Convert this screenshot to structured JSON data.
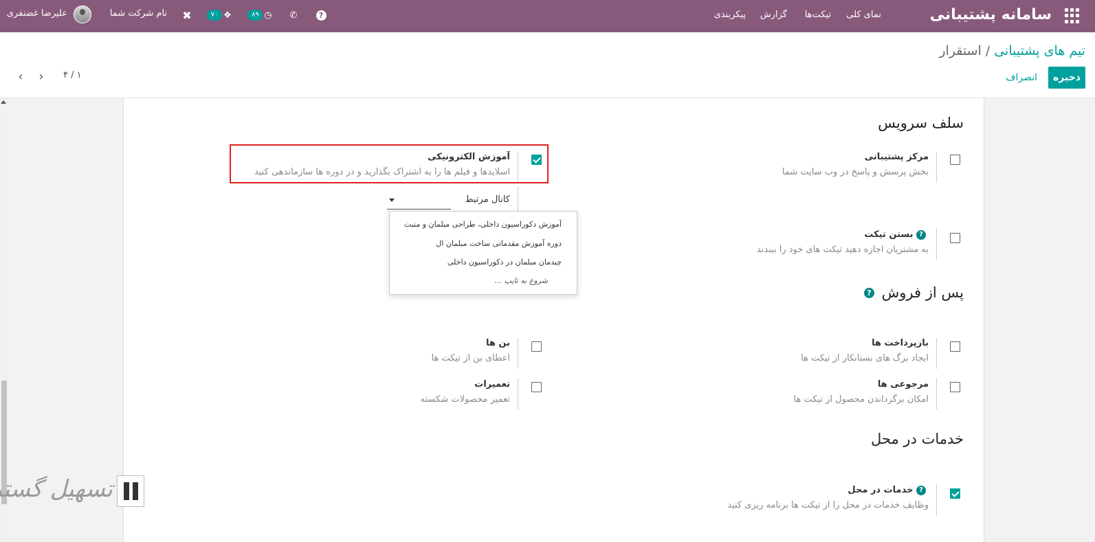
{
  "navbar": {
    "brand": "سامانه پشتیبانی",
    "menu": [
      "نمای کلی",
      "تیکت‌ها",
      "گزارش",
      "پیکربندی"
    ],
    "activity_count": "۸۹",
    "messages_count": "۷۰",
    "company": "نام شرکت شما",
    "username": "علیرضا غضنفری",
    "bg_color": "#875a7b"
  },
  "control_panel": {
    "breadcrumb_parent": "تیم های پشتیبانی",
    "breadcrumb_separator": "/",
    "breadcrumb_current": "استقرار",
    "save_label": "ذخیره",
    "discard_label": "انصراف",
    "pager": "۴ / ۱"
  },
  "sections": {
    "self_service": {
      "title": "سلف سرویس",
      "help_center": {
        "title": "مرکز پشتیبانی",
        "desc": "بخش پرسش و پاسخ در وب سایت شما",
        "checked": false
      },
      "elearning": {
        "title": "آموزش الکترونیکی",
        "desc": "اسلایدها و فیلم ها را به اشتراک بگذارید و در دوره ها سازماندهی کنید",
        "checked": true
      },
      "close_ticket": {
        "title": "بستن تیکت",
        "desc": "به مشتریان اجازه دهید تیکت های خود را ببندند",
        "checked": false
      },
      "channel_label": "کانال مرتبط",
      "channel_options": [
        "آموزش دکوراسیون داخلی، طراحی مبلمان و منبت",
        "دوره آموزش مقدماتی ساخت مبلمان ال",
        "چیدمان مبلمان در دکوراسیون داخلی"
      ],
      "channel_hint": "شروع به تایپ ..."
    },
    "after_sales": {
      "title": "پس از فروش",
      "refunds": {
        "title": "بازپرداخت ها",
        "desc": "ایجاد برگ های بستانکار از تیکت ها",
        "checked": false
      },
      "coupons": {
        "title": "بن ها",
        "desc": "اعطای بن از تیکت ها",
        "checked": false
      },
      "returns": {
        "title": "مرجوعی ها",
        "desc": "امکان برگرداندن محصول از تیکت ها",
        "checked": false
      },
      "repairs": {
        "title": "تعمیرات",
        "desc": "تعمیر محصولات شکسته",
        "checked": false
      }
    },
    "onsite": {
      "title": "خدمات در محل",
      "field_service": {
        "title": "خدمات در محل",
        "desc": "وظایف خدمات در محل را از تیکت ها برنامه ریزی کنید",
        "checked": true
      }
    }
  },
  "watermark": {
    "text": "تسهیل گستر"
  },
  "colors": {
    "accent": "#00a09d",
    "highlight": "#e02020"
  }
}
